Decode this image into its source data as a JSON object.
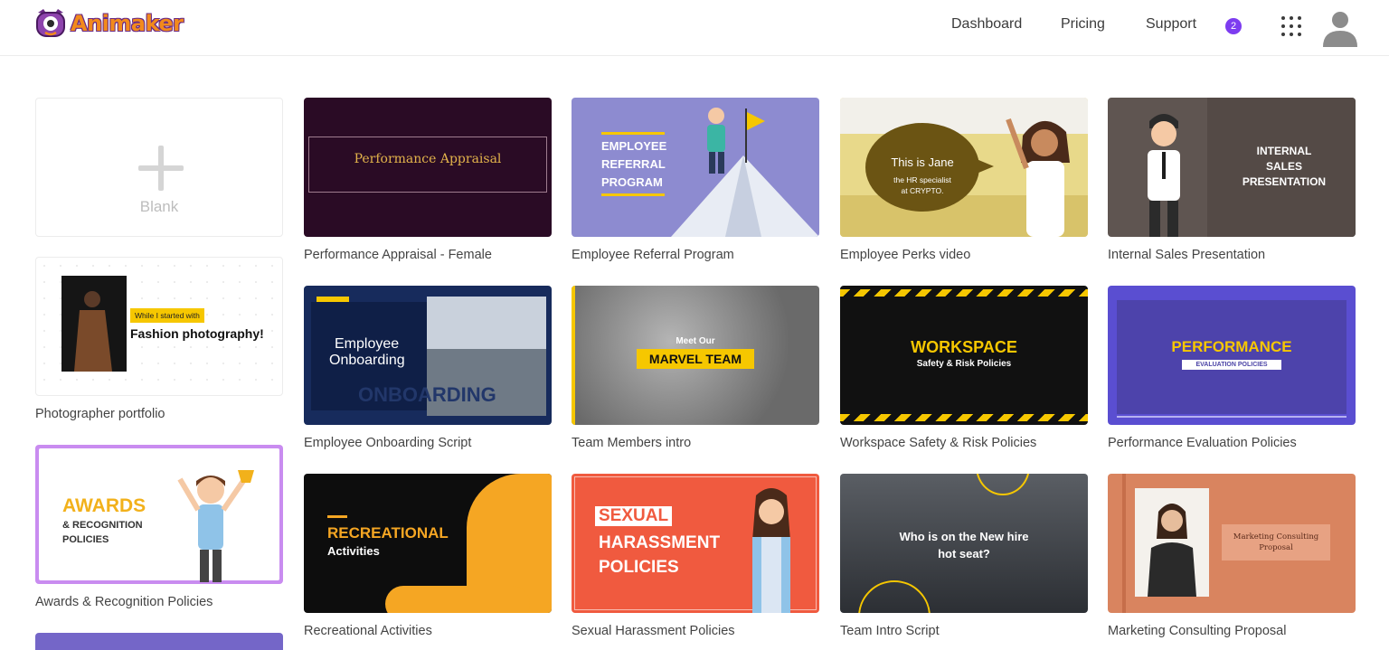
{
  "app": {
    "logo_text": "Animaker"
  },
  "nav": {
    "dashboard": "Dashboard",
    "pricing": "Pricing",
    "support": "Support",
    "notification_count": "2"
  },
  "blank": {
    "label": "Blank"
  },
  "templates": {
    "photographer": {
      "caption": "Photographer portfolio",
      "line1": "While I started with",
      "line2": "Fashion photography!"
    },
    "awards": {
      "caption": "Awards & Recognition Policies",
      "title": "AWARDS",
      "line2": "& RECOGNITION",
      "line3": "POLICIES"
    },
    "performance_appraisal": {
      "caption": "Performance Appraisal - Female",
      "title": "Performance Appraisal"
    },
    "referral": {
      "caption": "Employee Referral Program",
      "line1": "EMPLOYEE",
      "line2": "REFERRAL",
      "line3": "PROGRAM"
    },
    "perks": {
      "caption": "Employee Perks video",
      "title": "This is Jane",
      "sub1": "the HR specialist",
      "sub2": "at CRYPTO."
    },
    "internal_sales": {
      "caption": "Internal Sales Presentation",
      "line1": "INTERNAL",
      "line2": "SALES",
      "line3": "PRESENTATION"
    },
    "onboarding": {
      "caption": "Employee Onboarding Script",
      "line1": "Employee",
      "line2": "Onboarding",
      "bg_word": "ONBOARDING"
    },
    "team": {
      "caption": "Team Members intro",
      "line1": "Meet Our",
      "line2": "MARVEL TEAM"
    },
    "workspace": {
      "caption": "Workspace Safety & Risk Policies",
      "title": "WORKSPACE",
      "sub": "Safety & Risk Policies"
    },
    "performance_eval": {
      "caption": "Performance Evaluation Policies",
      "title": "PERFORMANCE",
      "sub": "EVALUATION POLICIES"
    },
    "recreational": {
      "caption": "Recreational Activities",
      "title": "RECREATIONAL",
      "sub": "Activities"
    },
    "harassment": {
      "caption": "Sexual Harassment Policies",
      "line1": "SEXUAL",
      "line2": "HARASSMENT",
      "line3": "POLICIES"
    },
    "team_intro": {
      "caption": "Team Intro Script",
      "line1": "Who is on the New hire",
      "line2": "hot seat?"
    },
    "marketing": {
      "caption": "Marketing Consulting Proposal",
      "line1": "Marketing Consulting",
      "line2": "Proposal"
    }
  },
  "colors": {
    "accent": "#7d3cf0",
    "perf_bg": "#2a0b25",
    "referral_bg": "#8d8bd0",
    "perks_bg": "#e8d98a",
    "sales_bg": "#5f5551",
    "onboarding_bg": "#172b5c",
    "workspace_bg": "#111111",
    "eval_bg": "#5a4ed1",
    "recreational_bg": "#f5a623",
    "harassment_bg": "#f05a3f",
    "marketing_bg": "#d9845f"
  }
}
